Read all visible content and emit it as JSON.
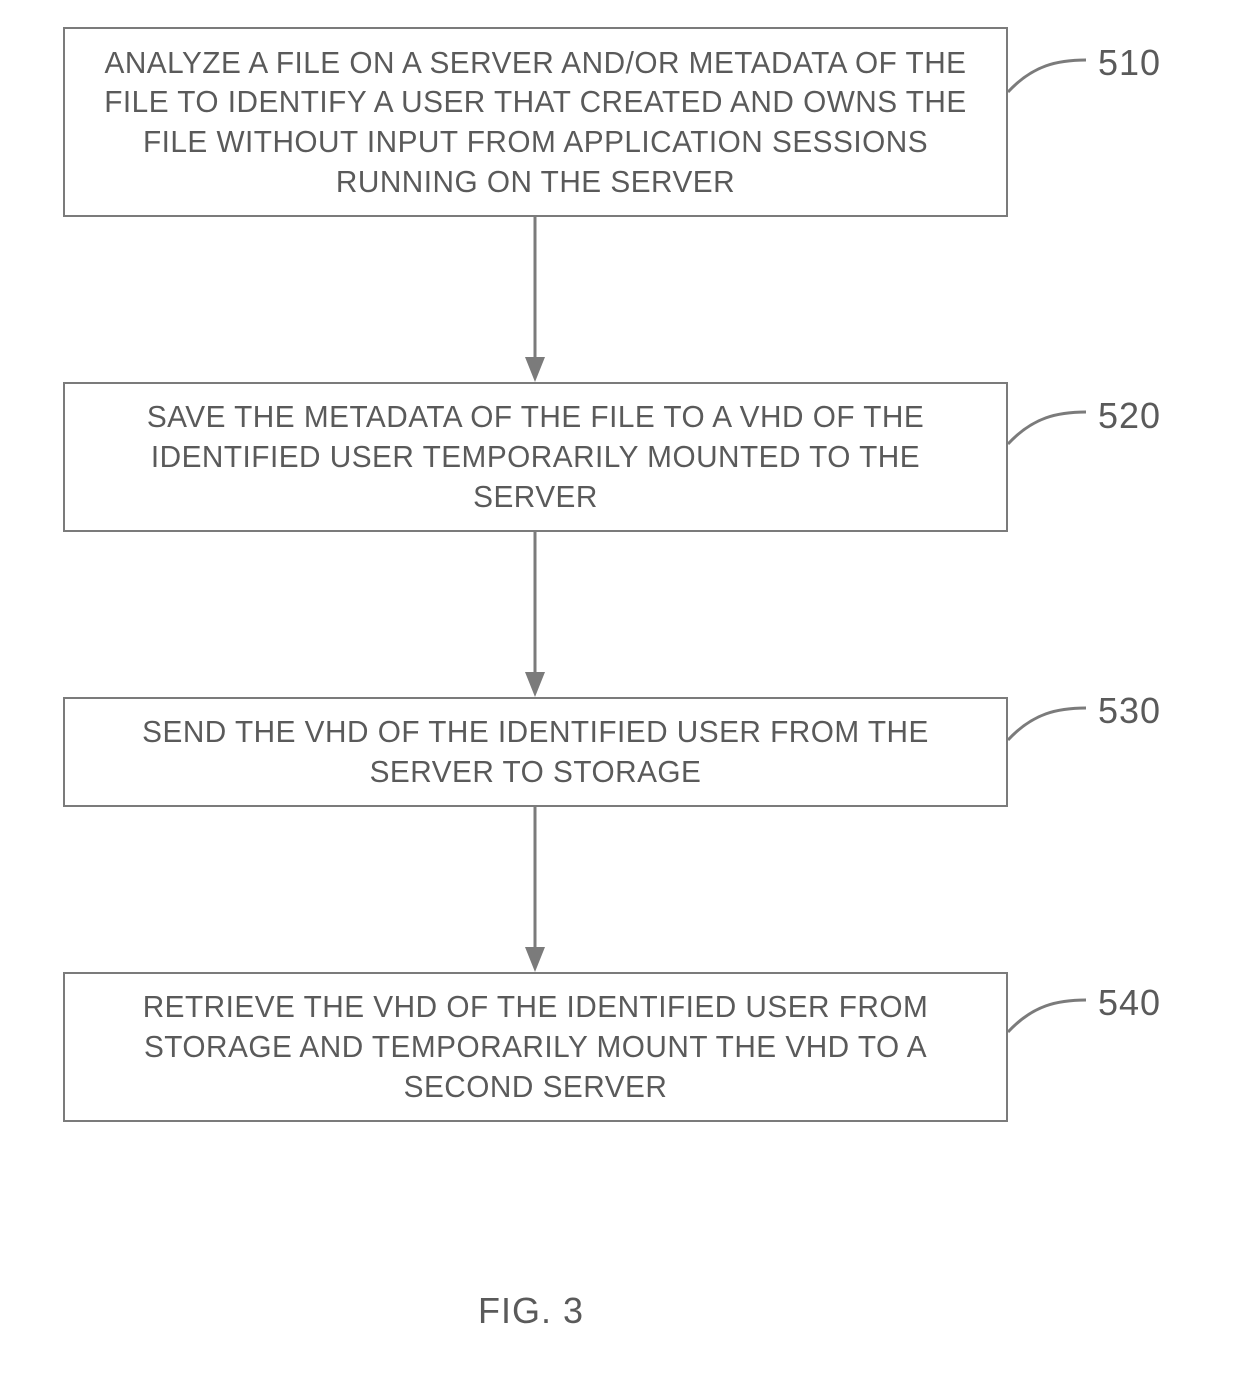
{
  "figure_label": "FIG. 3",
  "steps": [
    {
      "ref": "510",
      "text": "ANALYZE A FILE ON A SERVER AND/OR METADATA OF THE FILE TO IDENTIFY A USER THAT CREATED AND OWNS THE FILE WITHOUT  INPUT FROM APPLICATION SESSIONS RUNNING ON THE SERVER"
    },
    {
      "ref": "520",
      "text": "SAVE THE METADATA OF THE FILE TO A VHD OF THE IDENTIFIED USER TEMPORARILY MOUNTED TO THE SERVER"
    },
    {
      "ref": "530",
      "text": "SEND THE VHD OF THE IDENTIFIED USER FROM THE SERVER TO STORAGE"
    },
    {
      "ref": "540",
      "text": "RETRIEVE THE VHD OF THE IDENTIFIED USER FROM STORAGE AND TEMPORARILY MOUNT THE VHD TO A SECOND SERVER"
    }
  ]
}
